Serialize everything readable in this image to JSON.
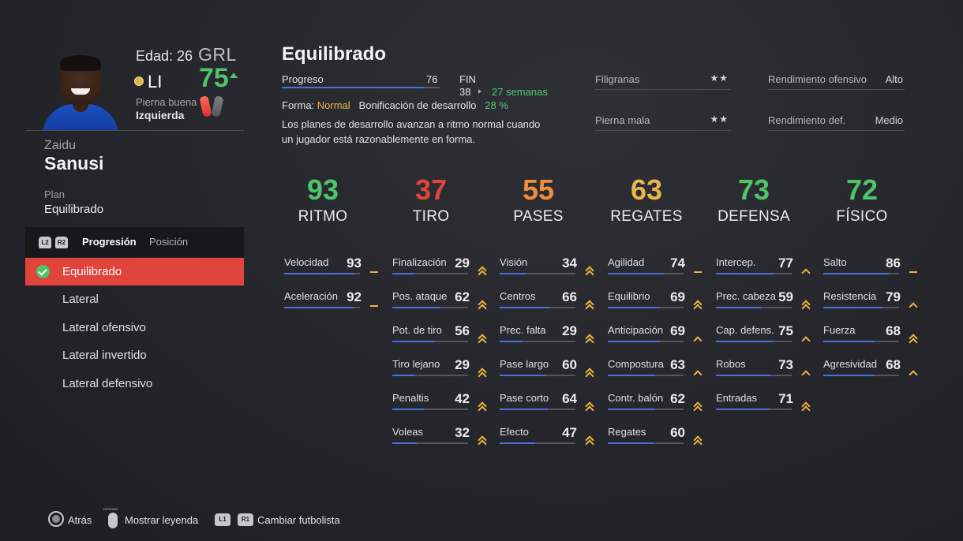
{
  "player": {
    "age_label": "Edad: 26",
    "ovr_label": "GRL",
    "ovr": "75",
    "position": "LI",
    "foot_label": "Pierna buena",
    "foot_value": "Izquierda",
    "first_name": "Zaidu",
    "last_name": "Sanusi",
    "plan_label": "Plan",
    "plan_value": "Equilibrado"
  },
  "tabs": {
    "l2": "L2",
    "r2": "R2",
    "progression": "Progresión",
    "position": "Posición"
  },
  "plans": [
    {
      "label": "Equilibrado",
      "selected": true
    },
    {
      "label": "Lateral",
      "selected": false
    },
    {
      "label": "Lateral ofensivo",
      "selected": false
    },
    {
      "label": "Lateral invertido",
      "selected": false
    },
    {
      "label": "Lateral defensivo",
      "selected": false
    }
  ],
  "info": {
    "title": "Equilibrado",
    "progress_label": "Progreso",
    "progress_value": "76",
    "progress_fraction": 0.9,
    "fin_label": "FIN",
    "fin_value": "38",
    "fin_weeks": "27 semanas",
    "forma_label": "Forma:",
    "forma_value": "Normal",
    "bonus_label": "Bonificación de desarrollo",
    "bonus_value": "28 %",
    "description": "Los planes de desarrollo avanzan a ritmo normal cuando un jugador está razonablemente en forma."
  },
  "attributes": {
    "skill_label": "Filigranas",
    "skill_value": "★★",
    "weakfoot_label": "Pierna mala",
    "weakfoot_value": "★★",
    "attack_label": "Rendimiento ofensivo",
    "attack_value": "Alto",
    "defense_label": "Rendimiento def.",
    "defense_value": "Medio"
  },
  "categories": [
    {
      "name": "RITMO",
      "value": "93",
      "color": "#4fc46a"
    },
    {
      "name": "TIRO",
      "value": "37",
      "color": "#e0443b"
    },
    {
      "name": "PASES",
      "value": "55",
      "color": "#ef8f3d"
    },
    {
      "name": "REGATES",
      "value": "63",
      "color": "#e8b64a"
    },
    {
      "name": "DEFENSA",
      "value": "73",
      "color": "#4fc46a"
    },
    {
      "name": "FÍSICO",
      "value": "72",
      "color": "#4fc46a"
    }
  ],
  "stats": [
    [
      {
        "label": "Velocidad",
        "value": "93",
        "trend": "flat"
      },
      {
        "label": "Aceleración",
        "value": "92",
        "trend": "flat"
      }
    ],
    [
      {
        "label": "Finalización",
        "value": "29",
        "trend": "up2"
      },
      {
        "label": "Pos. ataque",
        "value": "62",
        "trend": "up2"
      },
      {
        "label": "Pot. de tiro",
        "value": "56",
        "trend": "up2"
      },
      {
        "label": "Tiro lejano",
        "value": "29",
        "trend": "up2"
      },
      {
        "label": "Penaltis",
        "value": "42",
        "trend": "up2"
      },
      {
        "label": "Voleas",
        "value": "32",
        "trend": "up2"
      }
    ],
    [
      {
        "label": "Visión",
        "value": "34",
        "trend": "up2"
      },
      {
        "label": "Centros",
        "value": "66",
        "trend": "up2"
      },
      {
        "label": "Prec. falta",
        "value": "29",
        "trend": "up2"
      },
      {
        "label": "Pase largo",
        "value": "60",
        "trend": "up2"
      },
      {
        "label": "Pase corto",
        "value": "64",
        "trend": "up2"
      },
      {
        "label": "Efecto",
        "value": "47",
        "trend": "up2"
      }
    ],
    [
      {
        "label": "Agilidad",
        "value": "74",
        "trend": "flat"
      },
      {
        "label": "Equilibrio",
        "value": "69",
        "trend": "up2"
      },
      {
        "label": "Anticipación",
        "value": "69",
        "trend": "up1"
      },
      {
        "label": "Compostura",
        "value": "63",
        "trend": "up1"
      },
      {
        "label": "Contr. balón",
        "value": "62",
        "trend": "up2"
      },
      {
        "label": "Regates",
        "value": "60",
        "trend": "up2"
      }
    ],
    [
      {
        "label": "Intercep.",
        "value": "77",
        "trend": "up1"
      },
      {
        "label": "Prec. cabeza",
        "value": "59",
        "trend": "up2"
      },
      {
        "label": "Cap. defens.",
        "value": "75",
        "trend": "up1"
      },
      {
        "label": "Robos",
        "value": "73",
        "trend": "up1"
      },
      {
        "label": "Entradas",
        "value": "71",
        "trend": "up2"
      }
    ],
    [
      {
        "label": "Salto",
        "value": "86",
        "trend": "flat"
      },
      {
        "label": "Resistencia",
        "value": "79",
        "trend": "up1"
      },
      {
        "label": "Fuerza",
        "value": "68",
        "trend": "up2"
      },
      {
        "label": "Agresividad",
        "value": "68",
        "trend": "up1"
      }
    ]
  ],
  "footer": {
    "back": "Atrás",
    "legend": "Mostrar leyenda",
    "l1": "L1",
    "r1": "R1",
    "change": "Cambiar futbolista"
  }
}
